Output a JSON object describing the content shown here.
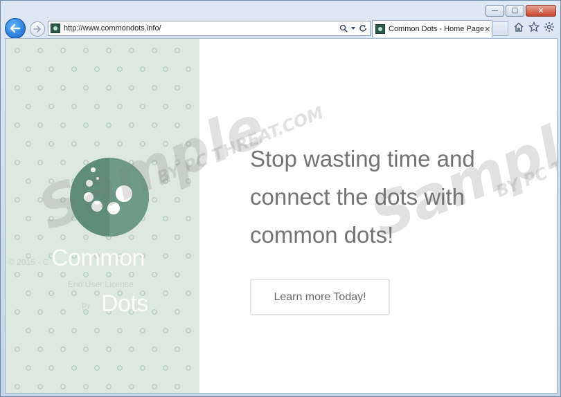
{
  "window": {
    "minimize_glyph": "—",
    "maximize_glyph": "□",
    "close_glyph": "✕"
  },
  "nav": {
    "back_icon": "back-arrow-icon",
    "forward_icon": "forward-arrow-icon",
    "address": "http://www.commondots.info/",
    "address_icons": [
      "search-icon",
      "dropdown-icon",
      "refresh-icon"
    ],
    "tab_title": "Common Dots - Home Page",
    "tab_close": "✕",
    "tool_icons": [
      "home-icon",
      "favorites-icon",
      "settings-icon"
    ]
  },
  "sidebar": {
    "brand_line1": "Common",
    "brand_line2": "Dots",
    "copyright": "© 2015 - C",
    "eula": "End User License",
    "privacy": "Pr"
  },
  "main": {
    "headline": "Stop wasting time and connect the dots with common dots!",
    "cta_label": "Learn more Today!"
  },
  "watermark": {
    "word": "Sample",
    "sub": "BY PC THREAT.COM"
  },
  "colors": {
    "sidebar_bg": "#dde8e0",
    "dot_color": "#b6cfbf",
    "logo_color": "#5e8d7a",
    "headline_color": "#737373"
  }
}
